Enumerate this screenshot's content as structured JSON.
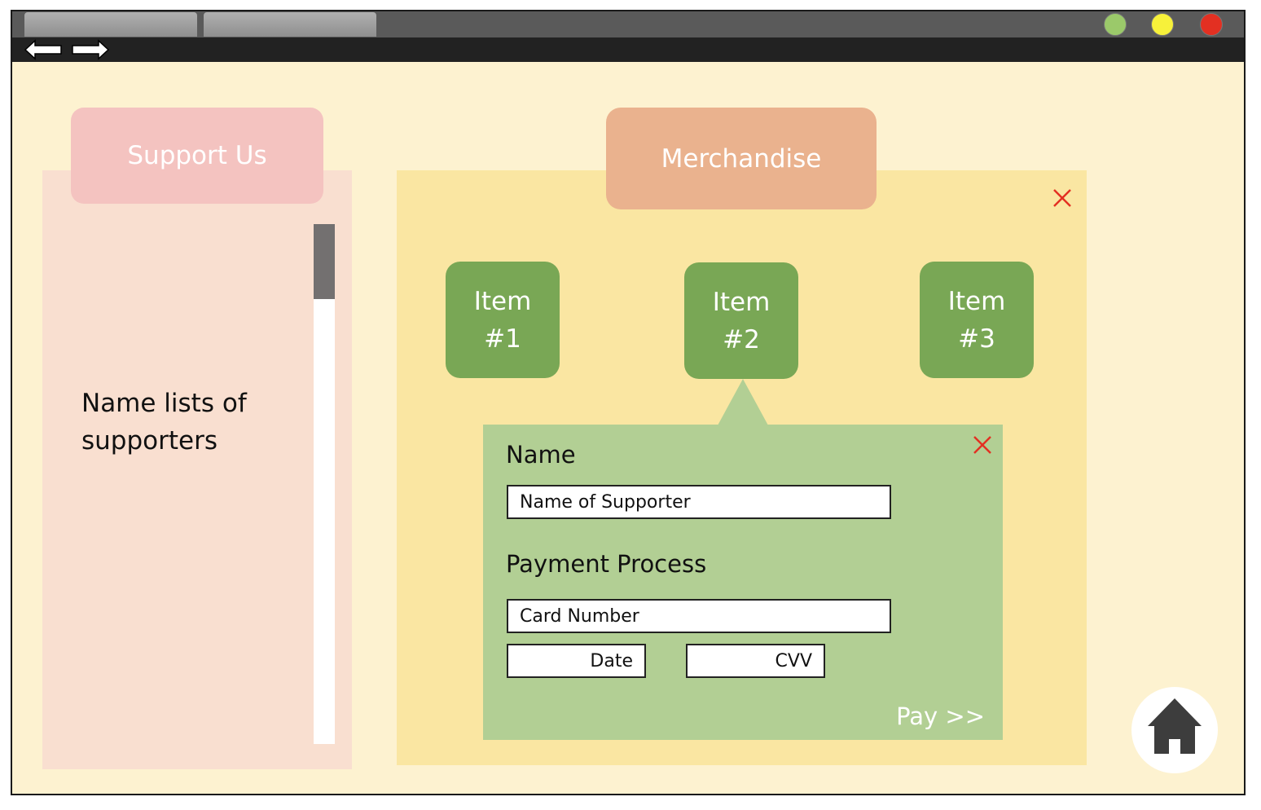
{
  "browser": {
    "tabs": [
      "",
      ""
    ],
    "window_buttons": {
      "green": "#9bc96a",
      "yellow": "#f7f13a",
      "red": "#e33022"
    },
    "nav": {
      "back": "back-arrow-icon",
      "forward": "forward-arrow-icon"
    }
  },
  "support": {
    "tab_label": "Support Us",
    "body_text": "Name lists of supporters"
  },
  "merch": {
    "tab_label": "Merchandise",
    "items": [
      {
        "label": "Item\n#1"
      },
      {
        "label": "Item\n#2"
      },
      {
        "label": "Item\n#3"
      }
    ]
  },
  "form": {
    "name_heading": "Name",
    "name_value": "Name of Supporter",
    "payment_heading": "Payment Process",
    "card_value": "Card Number",
    "date_value": "Date",
    "cvv_value": "CVV",
    "pay_label": "Pay >>"
  },
  "home": {
    "icon": "home-icon"
  },
  "colors": {
    "background": "#fdf2d0",
    "support_panel": "#f9dfd0",
    "support_tab": "#f4c3c0",
    "merch_panel": "#fae6a2",
    "merch_tab": "#eab28e",
    "item": "#79a755",
    "popup": "#b2cf94",
    "close": "#e33022"
  }
}
